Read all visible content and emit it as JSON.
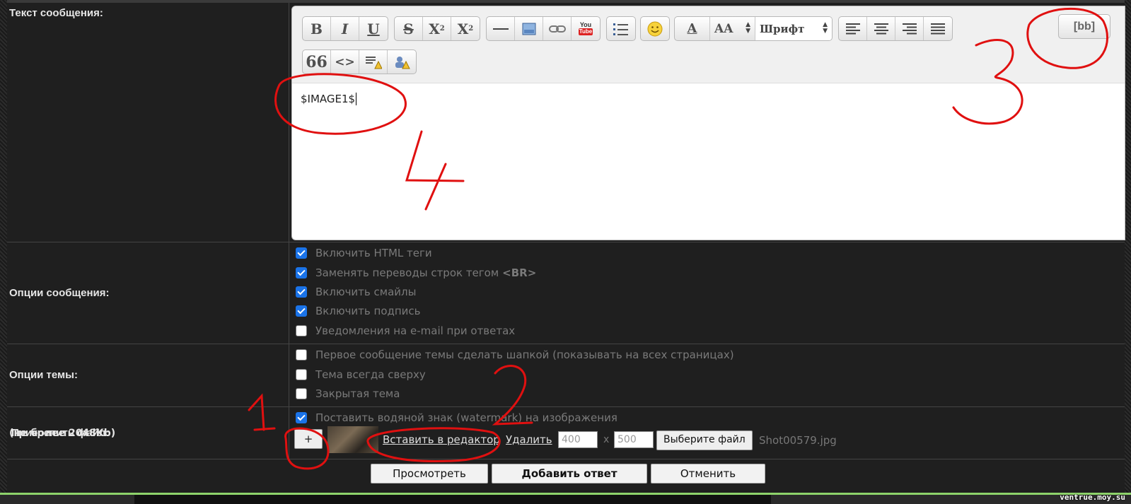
{
  "labels": {
    "message_text": "Текст сообщения:",
    "message_options": "Опции сообщения:",
    "topic_options": "Опции темы:",
    "attach_file": "Прикрепить файл:",
    "attach_limit": "(не более 2048Kb)"
  },
  "editor": {
    "toolbar": {
      "bold": "B",
      "italic": "I",
      "underline": "U",
      "strike": "S",
      "superscript": "X",
      "sup_mark": "2",
      "subscript": "X",
      "sub_mark": "2",
      "youtube_top": "You",
      "youtube_bottom": "Tube",
      "font_size": "AA",
      "font_select": "Шрифт",
      "quote": "66",
      "code": "<>",
      "bb_button": "[bb]"
    },
    "content": "$IMAGE1$"
  },
  "message_options": [
    {
      "label": "Включить HTML теги",
      "checked": true
    },
    {
      "label": "Заменять переводы строк тегом",
      "tag": "<BR>",
      "checked": true
    },
    {
      "label": "Включить смайлы",
      "checked": true
    },
    {
      "label": "Включить подпись",
      "checked": true
    },
    {
      "label": "Уведомления на e-mail при ответах",
      "checked": false
    }
  ],
  "topic_options": [
    {
      "label": "Первое сообщение темы сделать шапкой (показывать на всех страницах)",
      "checked": false
    },
    {
      "label": "Тема всегда сверху",
      "checked": false
    },
    {
      "label": "Закрытая тема",
      "checked": false
    }
  ],
  "attach": {
    "watermark_label": "Поставить водяной знак (watermark) на изображения",
    "watermark_checked": true,
    "add_label": "+",
    "insert_link": "Вставить в редактор",
    "delete_link": "Удалить",
    "width": "400",
    "x_sep": "x",
    "height": "500",
    "choose_file": "Выберите файл",
    "file_name": "Shot00579.jpg"
  },
  "actions": {
    "preview": "Просмотреть",
    "submit": "Добавить ответ",
    "cancel": "Отменить"
  },
  "annotations": {
    "n1": "1",
    "n2": "2",
    "n3": "3",
    "n4": "4"
  },
  "watermark": "ventrue.moy.su",
  "colors": {
    "annotation": "#e01010",
    "checkbox": "#1a73e8",
    "accent_line": "#8ed36b"
  }
}
